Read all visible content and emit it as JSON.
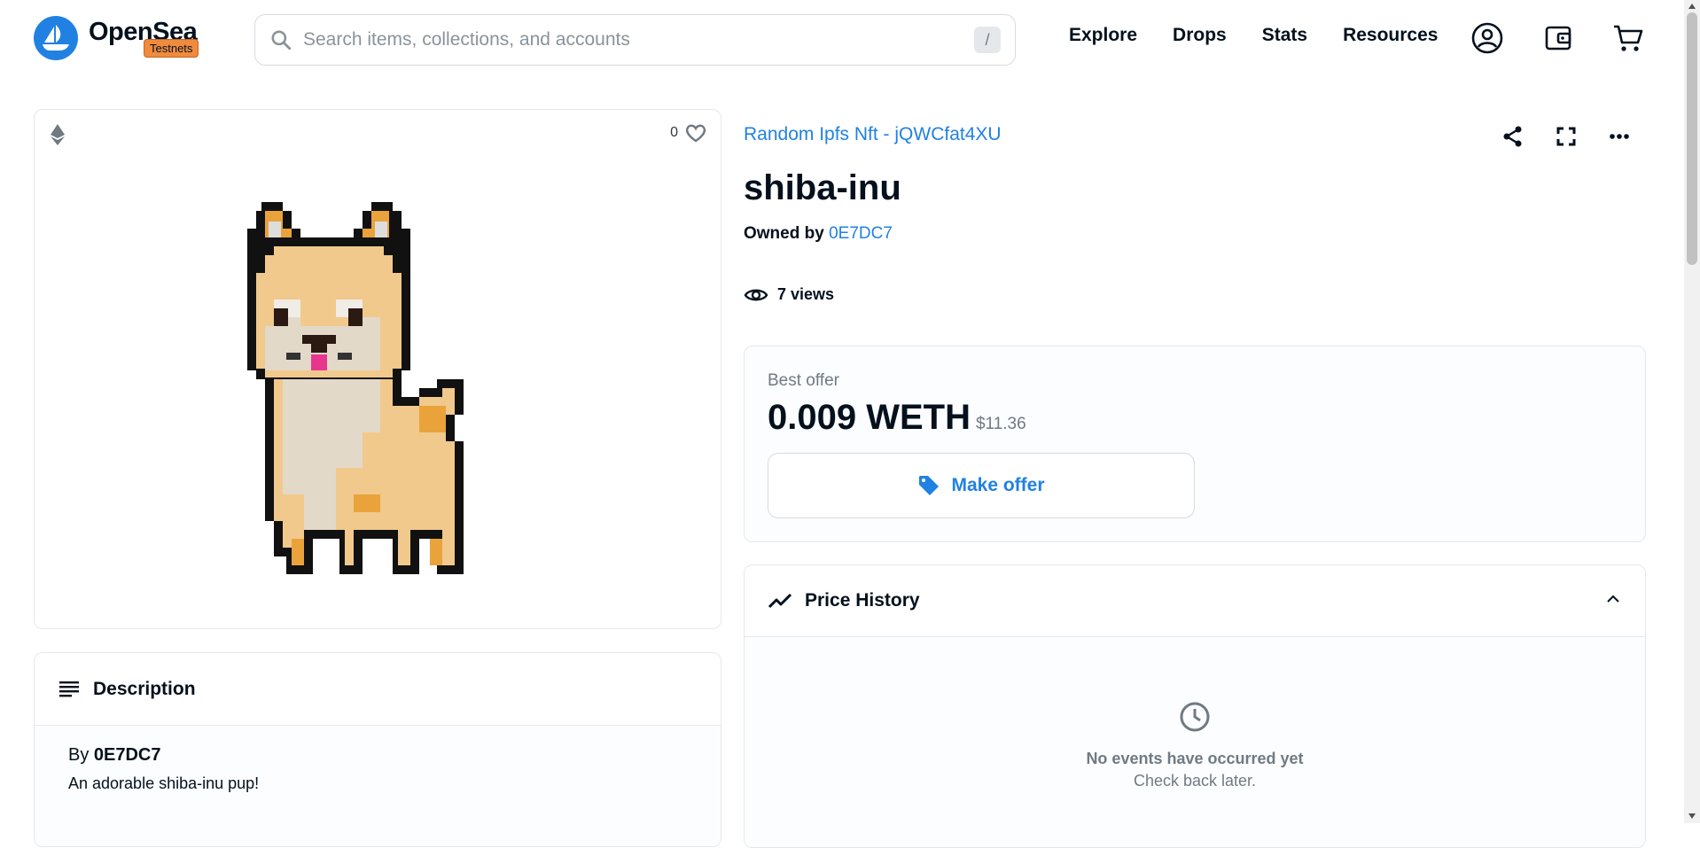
{
  "brand": {
    "name": "OpenSea",
    "badge": "Testnets"
  },
  "search": {
    "placeholder": "Search items, collections, and accounts",
    "shortcut": "/"
  },
  "nav": {
    "explore": "Explore",
    "drops": "Drops",
    "stats": "Stats",
    "resources": "Resources"
  },
  "media": {
    "favorites_count": "0"
  },
  "description": {
    "title": "Description",
    "by_label": "By",
    "by_value": "0E7DC7",
    "text": "An adorable shiba-inu pup!"
  },
  "item": {
    "collection": "Random Ipfs Nft - jQWCfat4XU",
    "title": "shiba-inu",
    "owned_by_label": "Owned by",
    "owner": "0E7DC7",
    "views": "7 views"
  },
  "offer": {
    "label": "Best offer",
    "value": "0.009 WETH",
    "usd": "$11.36",
    "button": "Make offer"
  },
  "price_history": {
    "title": "Price History",
    "empty_title": "No events have occurred yet",
    "empty_subtitle": "Check back later."
  },
  "colors": {
    "accent": "#2081e2",
    "badge": "#f08b3e"
  }
}
